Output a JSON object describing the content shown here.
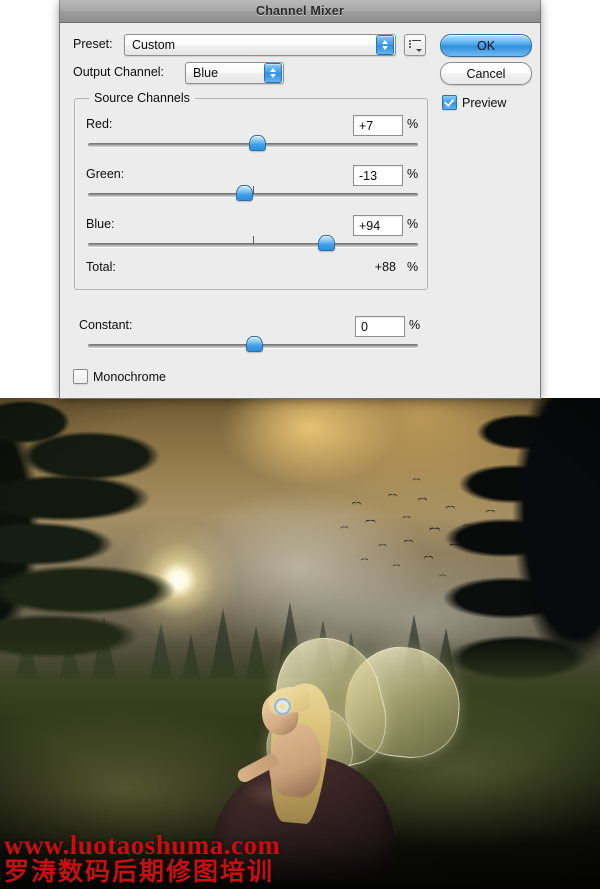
{
  "window": {
    "title": "Channel Mixer"
  },
  "preset": {
    "label": "Preset:",
    "value": "Custom",
    "menu_icon": "preset-options-icon"
  },
  "output_channel": {
    "label": "Output Channel:",
    "value": "Blue"
  },
  "buttons": {
    "ok": "OK",
    "cancel": "Cancel"
  },
  "preview": {
    "label": "Preview",
    "checked": true
  },
  "source_channels": {
    "title": "Source Channels",
    "percent_symbol": "%",
    "rows": [
      {
        "label": "Red:",
        "value": "+7",
        "slider_percent": 51
      },
      {
        "label": "Green:",
        "value": "-13",
        "slider_percent": 47
      },
      {
        "label": "Blue:",
        "value": "+94",
        "slider_percent": 72
      }
    ],
    "total": {
      "label": "Total:",
      "value": "+88",
      "percent_symbol": "%"
    }
  },
  "constant": {
    "label": "Constant:",
    "value": "0",
    "percent_symbol": "%",
    "slider_percent": 50
  },
  "monochrome": {
    "label": "Monochrome",
    "checked": false
  },
  "watermark": {
    "url": "www.luotaoshuma.com",
    "chinese": "罗涛数码后期修图培训",
    "color": "#cc0d0d"
  },
  "photo": {
    "description": "fantasy forest scene with glowing light, flying birds and a winged fairy kneeling in grass"
  },
  "colors": {
    "accent_blue": "#3f9fe8",
    "dialog_background": "#ececec",
    "titlebar": "#a8a8a8"
  }
}
